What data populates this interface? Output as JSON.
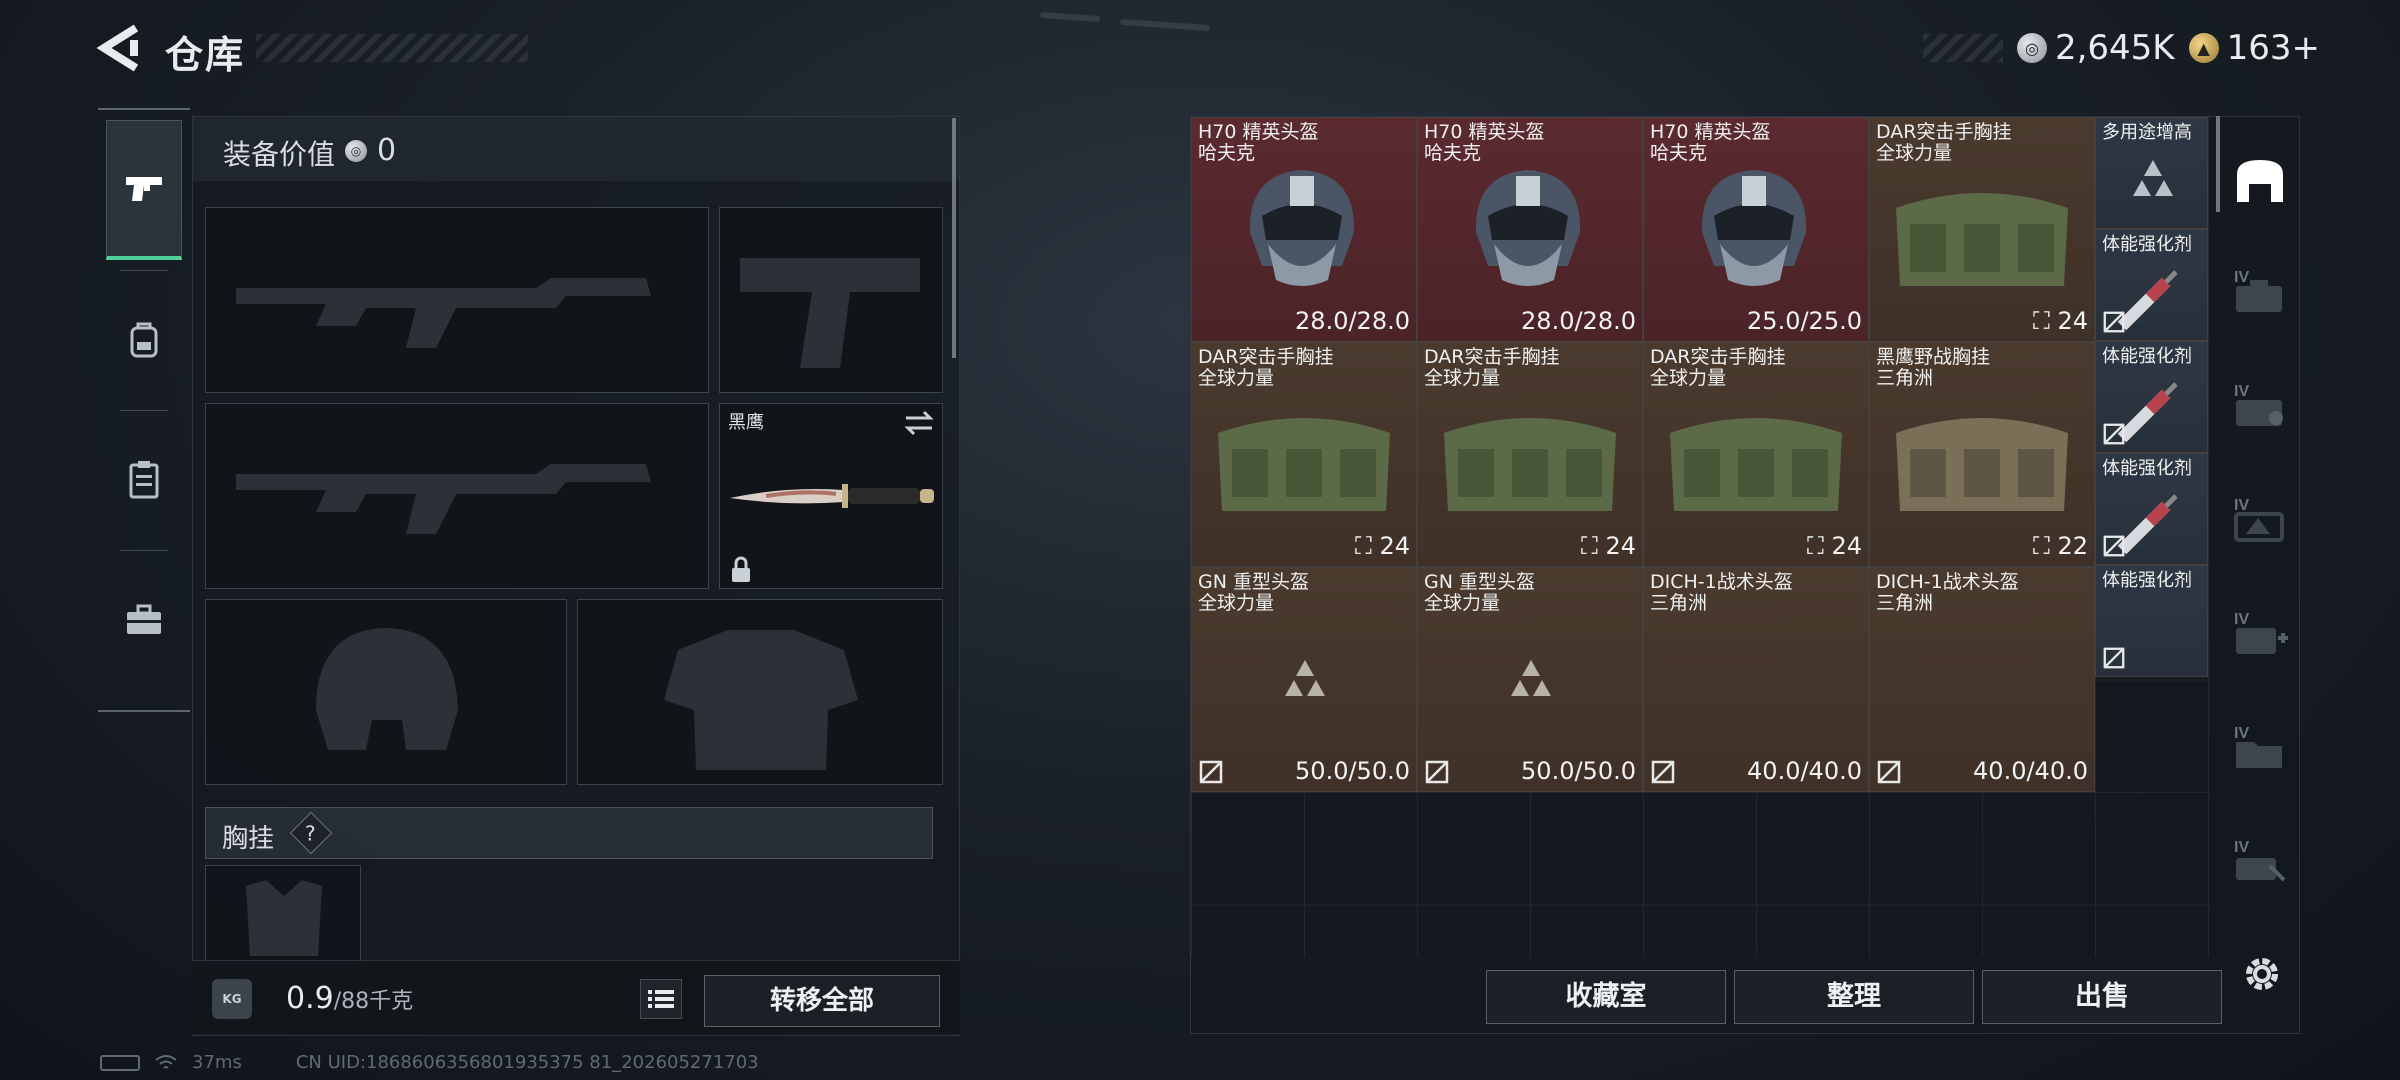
{
  "header": {
    "title": "仓库",
    "currency_silver": "2,645K",
    "currency_gold": "163+"
  },
  "nav": {
    "items": [
      {
        "icon": "pistol-icon",
        "active": true
      },
      {
        "icon": "backpack-icon",
        "active": false
      },
      {
        "icon": "clipboard-icon",
        "active": false
      },
      {
        "icon": "toolbox-icon",
        "active": false
      }
    ]
  },
  "equipment": {
    "value_label": "装备价值",
    "value": "0",
    "melee_name": "黑鹰",
    "chest_label": "胸挂",
    "chest_help": "?",
    "weight_current": "0.9",
    "weight_max": "/88千克",
    "kg_icon_label": "KG",
    "transfer_all": "转移全部"
  },
  "storage": {
    "items": [
      {
        "name": "H70 精英头盔",
        "sub": "哈夫克",
        "value": "28.0/28.0",
        "color": "red"
      },
      {
        "name": "H70 精英头盔",
        "sub": "哈夫克",
        "value": "28.0/28.0",
        "color": "red"
      },
      {
        "name": "H70 精英头盔",
        "sub": "哈夫克",
        "value": "25.0/25.0",
        "color": "red"
      },
      {
        "name": "DAR突击手胸挂",
        "sub": "全球力量",
        "value": "24",
        "color": "brown"
      },
      {
        "name": "DAR突击手胸挂",
        "sub": "全球力量",
        "value": "24",
        "color": "brown"
      },
      {
        "name": "DAR突击手胸挂",
        "sub": "全球力量",
        "value": "24",
        "color": "brown"
      },
      {
        "name": "DAR突击手胸挂",
        "sub": "全球力量",
        "value": "24",
        "color": "brown"
      },
      {
        "name": "黑鹰野战胸挂",
        "sub": "三角洲",
        "value": "22",
        "color": "brown"
      },
      {
        "name": "GN 重型头盔",
        "sub": "全球力量",
        "value": "50.0/50.0",
        "color": "brown"
      },
      {
        "name": "GN 重型头盔",
        "sub": "全球力量",
        "value": "50.0/50.0",
        "color": "brown"
      },
      {
        "name": "DICH-1战术头盔",
        "sub": "三角洲",
        "value": "40.0/40.0",
        "color": "brown"
      },
      {
        "name": "DICH-1战术头盔",
        "sub": "三角洲",
        "value": "40.0/40.0",
        "color": "brown"
      }
    ],
    "small_items": [
      {
        "name": "多用途增高"
      },
      {
        "name": "体能强化剂"
      },
      {
        "name": "体能强化剂"
      },
      {
        "name": "体能强化剂"
      },
      {
        "name": "体能强化剂"
      }
    ],
    "buttons": {
      "collection": "收藏室",
      "organize": "整理",
      "sell": "出售"
    },
    "side_tab_label": "IV"
  },
  "status": {
    "ping": "37ms",
    "uid": "CN UID:1868606356801935375 81_202605271703"
  },
  "colors": {
    "accent_green": "#4fd09a",
    "rarity_red": "#5a2a30",
    "rarity_brown": "#4a3a2e",
    "rarity_slate": "#2e3844"
  }
}
